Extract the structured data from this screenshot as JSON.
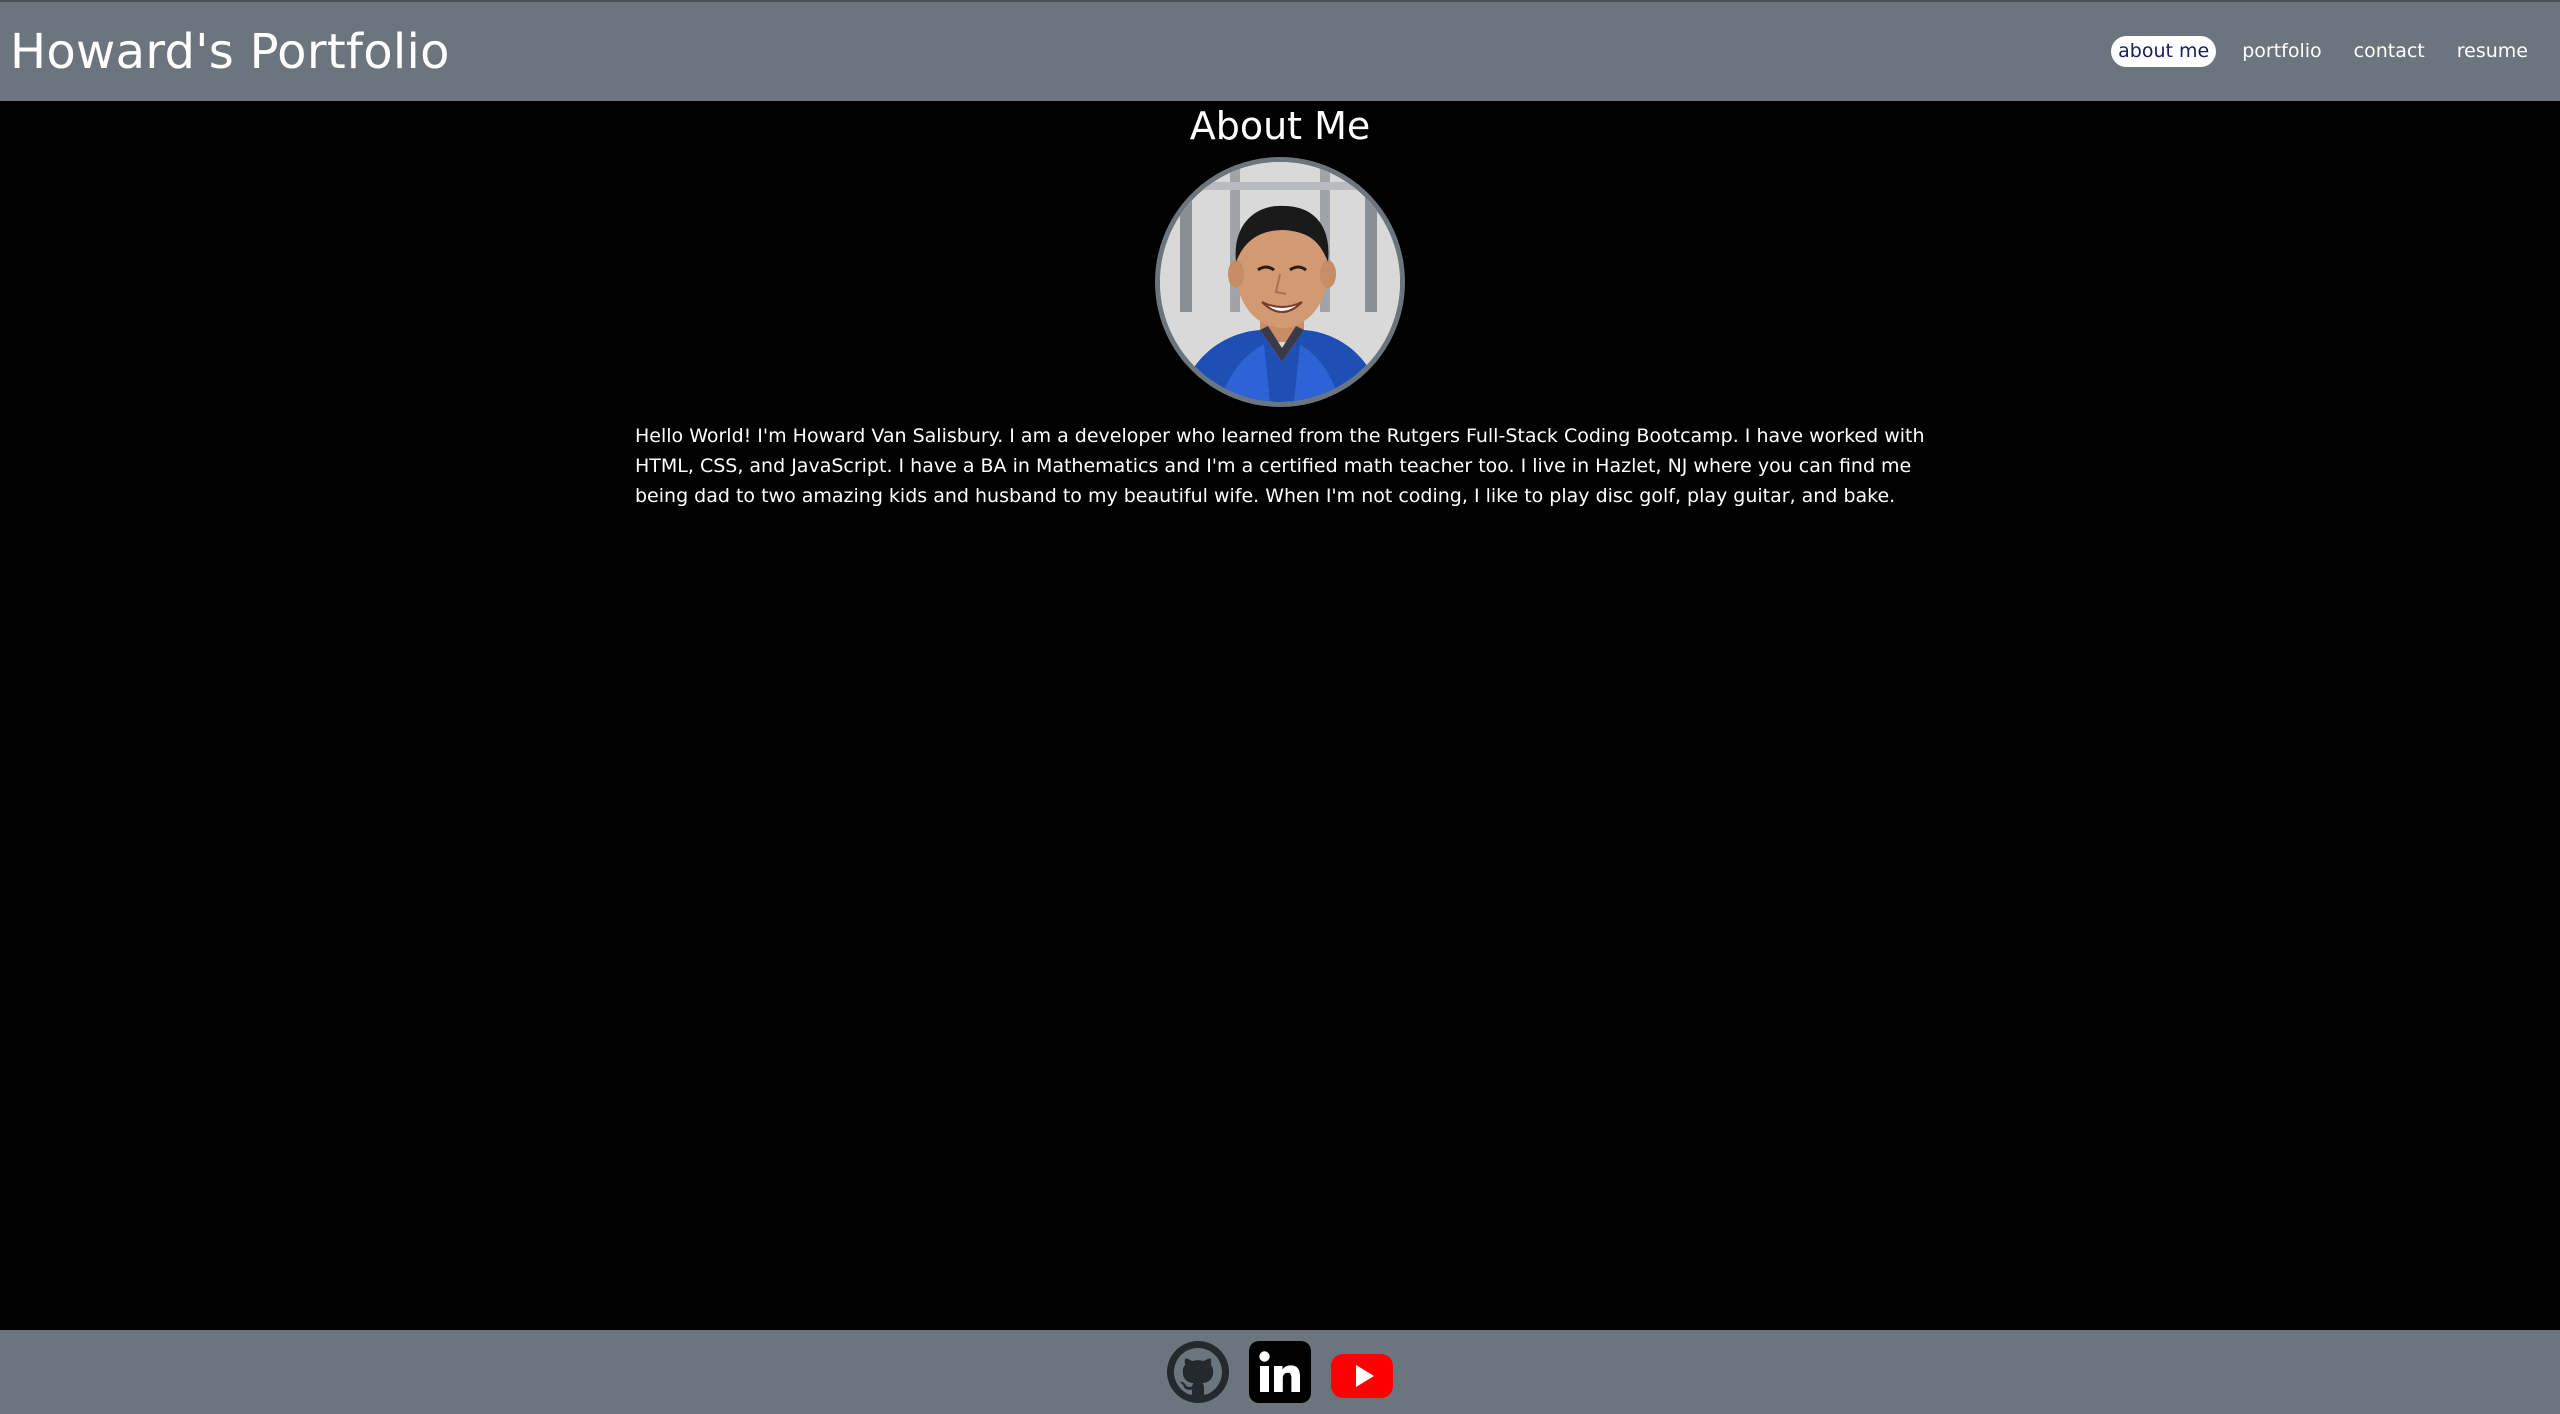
{
  "header": {
    "title": "Howard's Portfolio",
    "nav": [
      {
        "label": "about me",
        "active": true
      },
      {
        "label": "portfolio",
        "active": false
      },
      {
        "label": "contact",
        "active": false
      },
      {
        "label": "resume",
        "active": false
      }
    ]
  },
  "main": {
    "heading": "About Me",
    "bio": "Hello World! I'm Howard Van Salisbury. I am a developer who learned from the Rutgers Full-Stack Coding Bootcamp. I have worked with HTML, CSS, and JavaScript. I have a BA in Mathematics and I'm a certified math teacher too. I live in Hazlet, NJ where you can find me being dad to two amazing kids and husband to my beautiful wife. When I'm not coding, I like to play disc golf, play guitar, and bake."
  },
  "footer": {
    "social_icons": [
      "github-icon",
      "linkedin-icon",
      "youtube-icon"
    ]
  },
  "colors": {
    "header_bg": "#6c757d",
    "page_bg": "#000000",
    "active_nav_bg": "#ffffff",
    "active_nav_text": "#1a1a5e",
    "youtube_red": "#ff0000"
  }
}
